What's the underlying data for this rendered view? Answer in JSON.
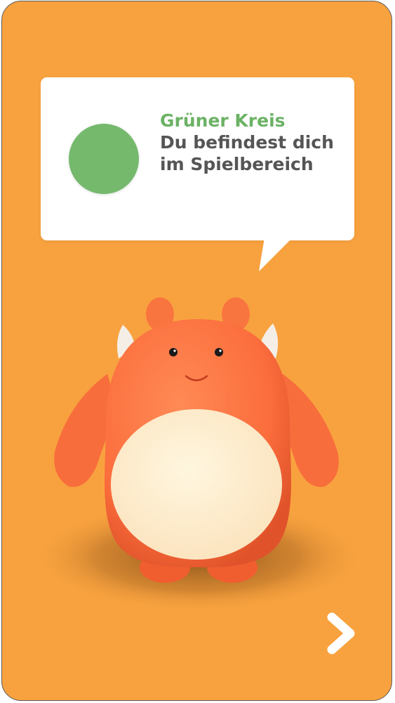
{
  "card": {
    "background_color": "#f8a23f"
  },
  "message": {
    "indicator_color": "#75b96d",
    "title": "Grüner Kreis",
    "title_color": "#6cb265",
    "body": "Du befindest dich im Spielbereich",
    "body_color": "#555555"
  },
  "mascot": {
    "icon": "orange-monster-mascot"
  },
  "navigation": {
    "next_icon": "chevron-right-icon"
  }
}
